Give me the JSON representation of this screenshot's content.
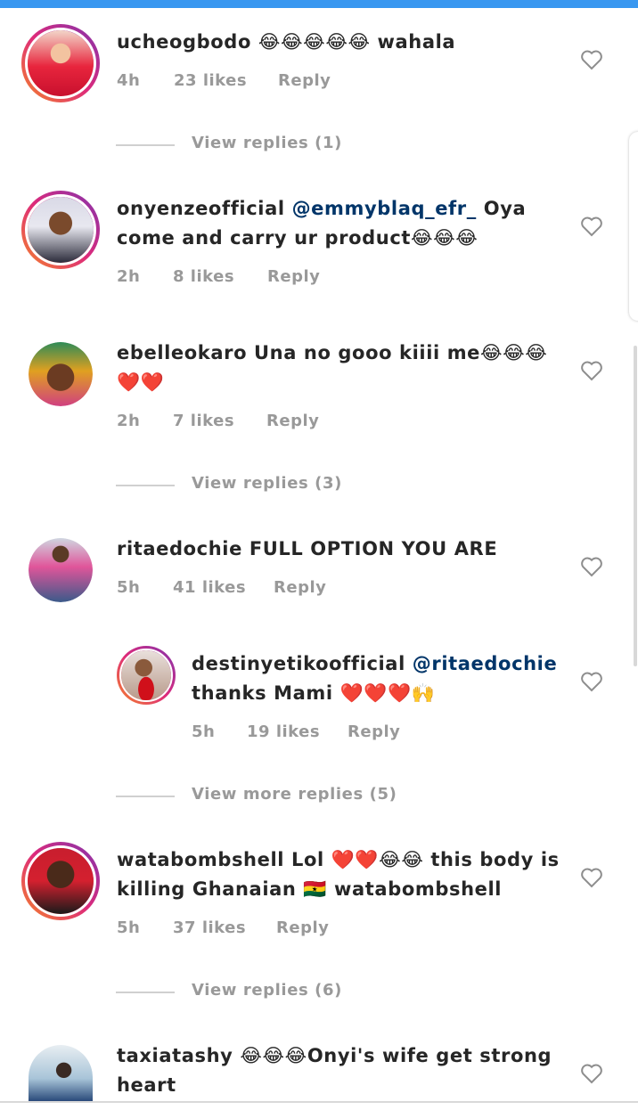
{
  "comments": [
    {
      "username": "ucheogbodo",
      "text_lines": [
        "😂😂😂😂😂 wahala"
      ],
      "time": "4h",
      "likes": "23 likes",
      "reply": "Reply",
      "view_replies": "View replies (1)"
    },
    {
      "username": "onyenzeofficial",
      "mention": "@emmyblaq_efr_",
      "text_after_mention": "Oya",
      "text_line2": "come and carry ur product😂😂😂",
      "time": "2h",
      "likes": "8 likes",
      "reply": "Reply"
    },
    {
      "username": "ebelleokaro",
      "text": "Una no gooo kiiii me😂😂😂",
      "text_line2": "❤️❤️",
      "time": "2h",
      "likes": "7 likes",
      "reply": "Reply",
      "view_replies": "View replies (3)"
    },
    {
      "username": "ritaedochie",
      "text": "FULL OPTION YOU ARE",
      "time": "5h",
      "likes": "41 likes",
      "reply": "Reply",
      "reply_comment": {
        "username": "destinyetikoofficial",
        "mention": "@ritaedochie",
        "text_line2": "thanks Mami ❤️❤️❤️🙌",
        "time": "5h",
        "likes": "19 likes",
        "reply": "Reply"
      },
      "view_replies": "View more replies (5)"
    },
    {
      "username": "watabombshell",
      "text": "Lol ❤️❤️😂😂 this body is",
      "text_line2": "killing Ghanaian 🇬🇭 watabombshell",
      "time": "5h",
      "likes": "37 likes",
      "reply": "Reply",
      "view_replies": "View replies (6)"
    },
    {
      "username": "taxiatashy",
      "text": "😂😂😂Onyi's wife get strong",
      "text_line2": "heart"
    }
  ],
  "colors": {
    "accent": "#3897f0",
    "mention": "#003569",
    "meta": "#999999"
  },
  "icons": {
    "like": "heart-outline-icon"
  }
}
